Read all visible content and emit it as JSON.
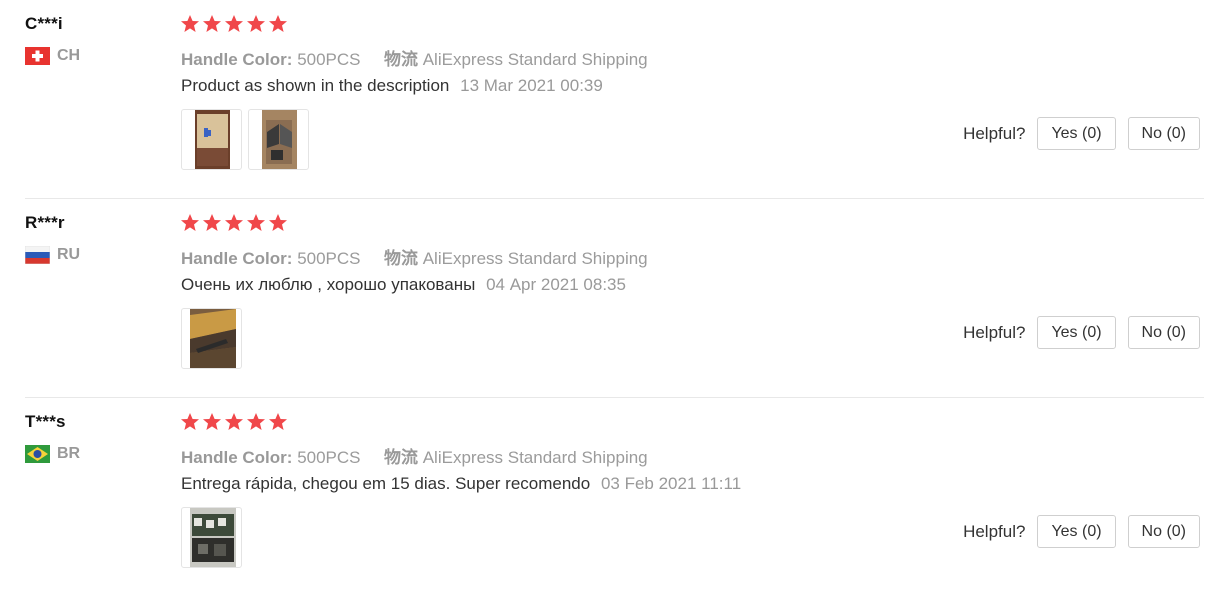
{
  "colors": {
    "star": "#f0474a",
    "muted": "#999999",
    "divider": "#e8e8e8"
  },
  "reviews": [
    {
      "user": "C***i",
      "country": "CH",
      "flag_icon": "switzerland-flag-icon",
      "rating": 5,
      "attr_label": "Handle Color:",
      "attr_value": "500PCS",
      "logistics_label": "物流",
      "logistics_value": "AliExpress Standard Shipping",
      "feedback": "Product as shown in the description",
      "date": "13 Mar 2021 00:39",
      "photos": [
        "product-photo-1",
        "product-photo-2"
      ],
      "helpful_label": "Helpful?",
      "yes_label": "Yes (0)",
      "no_label": "No (0)"
    },
    {
      "user": "R***r",
      "country": "RU",
      "flag_icon": "russia-flag-icon",
      "rating": 5,
      "attr_label": "Handle Color:",
      "attr_value": "500PCS",
      "logistics_label": "物流",
      "logistics_value": "AliExpress Standard Shipping",
      "feedback": "Очень их люблю , хорошо упакованы",
      "date": "04 Apr 2021 08:35",
      "photos": [
        "product-photo-1"
      ],
      "helpful_label": "Helpful?",
      "yes_label": "Yes (0)",
      "no_label": "No (0)"
    },
    {
      "user": "T***s",
      "country": "BR",
      "flag_icon": "brazil-flag-icon",
      "rating": 5,
      "attr_label": "Handle Color:",
      "attr_value": "500PCS",
      "logistics_label": "物流",
      "logistics_value": "AliExpress Standard Shipping",
      "feedback": "Entrega rápida, chegou em 15 dias. Super recomendo",
      "date": "03 Feb 2021 11:11",
      "photos": [
        "product-photo-1"
      ],
      "helpful_label": "Helpful?",
      "yes_label": "Yes (0)",
      "no_label": "No (0)"
    }
  ]
}
